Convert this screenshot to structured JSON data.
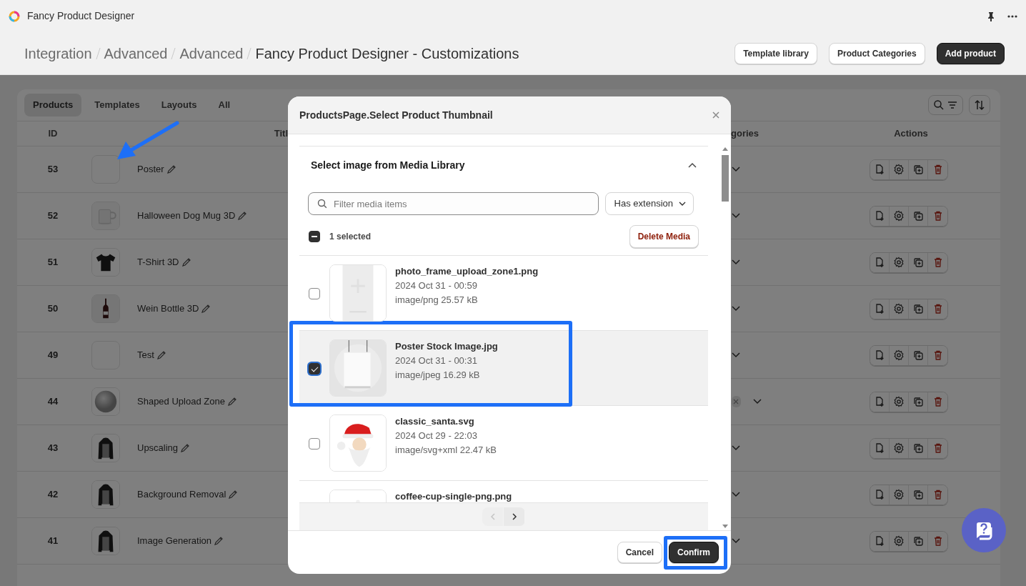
{
  "app": {
    "title": "Fancy Product Designer"
  },
  "breadcrumbs": [
    "Integration",
    "Advanced",
    "Advanced",
    "Fancy Product Designer - Customizations"
  ],
  "header_buttons": [
    {
      "label": "Template library",
      "primary": false
    },
    {
      "label": "Product Categories",
      "primary": false
    },
    {
      "label": "Add product",
      "primary": true
    }
  ],
  "tabs": [
    {
      "label": "Products",
      "selected": true
    },
    {
      "label": "Templates",
      "selected": false
    },
    {
      "label": "Layouts",
      "selected": false
    },
    {
      "label": "All",
      "selected": false
    }
  ],
  "table": {
    "columns": [
      "ID",
      "Titl",
      "gories",
      "Actions"
    ],
    "rows": [
      {
        "id": "53",
        "title": "Poster",
        "has_thumbnail": false,
        "has_tag": false
      },
      {
        "id": "52",
        "title": "Halloween Dog Mug 3D",
        "has_thumbnail": true,
        "has_tag": false
      },
      {
        "id": "51",
        "title": "T-Shirt 3D",
        "has_thumbnail": true,
        "has_tag": false
      },
      {
        "id": "50",
        "title": "Wein Bottle 3D",
        "has_thumbnail": true,
        "has_tag": false
      },
      {
        "id": "49",
        "title": "Test",
        "has_thumbnail": false,
        "has_tag": false
      },
      {
        "id": "44",
        "title": "Shaped Upload Zone",
        "has_thumbnail": true,
        "has_tag": true
      },
      {
        "id": "43",
        "title": "Upscaling",
        "has_thumbnail": true,
        "has_tag": false
      },
      {
        "id": "42",
        "title": "Background Removal",
        "has_thumbnail": true,
        "has_tag": false
      },
      {
        "id": "41",
        "title": "Image Generation",
        "has_thumbnail": true,
        "has_tag": false
      }
    ]
  },
  "modal": {
    "title": "ProductsPage.Select Product Thumbnail",
    "section_title": "Select image from Media Library",
    "expanded": true,
    "search": {
      "placeholder": "Filter media items"
    },
    "filter": "Has extension",
    "selection": {
      "label": "1 selected",
      "indeterminate": true
    },
    "delete_button": "Delete Media",
    "items": [
      {
        "name": "photo_frame_upload_zone1.png",
        "date": "2024 Oct 31 - 00:59",
        "meta": "image/png 25.57 kB",
        "selected": false
      },
      {
        "name": "Poster Stock Image.jpg",
        "date": "2024 Oct 31 - 00:31",
        "meta": "image/jpeg 16.29 kB",
        "selected": true
      },
      {
        "name": "classic_santa.svg",
        "date": "2024 Oct 29 - 22:03",
        "meta": "image/svg+xml 22.47 kB",
        "selected": false
      },
      {
        "name": "coffee-cup-single-png.png",
        "selected": false
      }
    ],
    "pagination": {
      "prev_disabled": true,
      "next_disabled": false
    },
    "buttons": [
      {
        "label": "Cancel",
        "primary": false
      },
      {
        "label": "Confirm",
        "primary": true
      }
    ]
  }
}
